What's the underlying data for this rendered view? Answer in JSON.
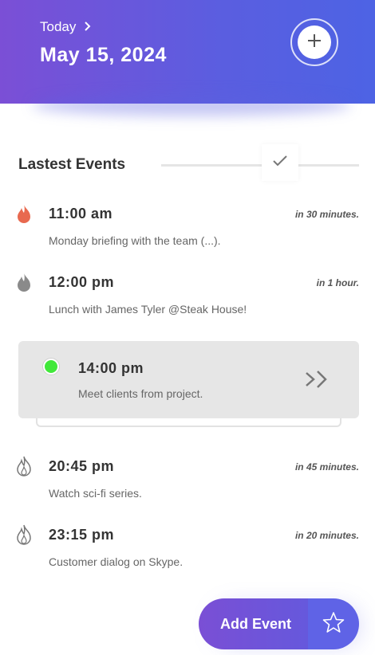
{
  "header": {
    "today_label": "Today",
    "date": "May 15, 2024"
  },
  "section": {
    "title": "Lastest Events"
  },
  "events": [
    {
      "time": "11:00 am",
      "relative": "in 30 minutes.",
      "description": "Monday briefing with the team (...).",
      "icon": "flame-red-icon"
    },
    {
      "time": "12:00 pm",
      "relative": "in 1 hour.",
      "description": "Lunch with James Tyler @Steak House!",
      "icon": "flame-gray-icon"
    },
    {
      "time": "14:00 pm",
      "description": "Meet clients from project.",
      "icon": "status-dot-green"
    },
    {
      "time": "20:45 pm",
      "relative": "in 45 minutes.",
      "description": "Watch sci-fi series.",
      "icon": "flame-outline-icon"
    },
    {
      "time": "23:15 pm",
      "relative": "in 20 minutes.",
      "description": "Customer dialog on Skype.",
      "icon": "flame-outline-icon"
    }
  ],
  "fab": {
    "label": "Add Event"
  },
  "colors": {
    "header_start": "#7b4fd6",
    "header_end": "#4d63e4",
    "active_dot": "#41e83a",
    "flame_red": "#e8694f"
  }
}
